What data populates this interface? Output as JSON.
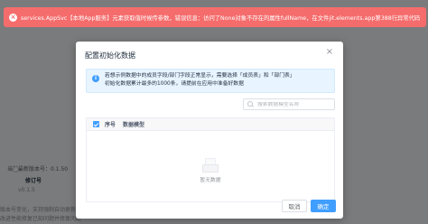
{
  "toast": {
    "type": "error",
    "message": "services.AppSvc【本地App服务】元素获取值时候传参数，错误信息：访问了None对象不存在的属性fullName，在文件jit.elements.app第388行异常代码"
  },
  "background": {
    "version_label": "当前最新版本号：0.1.50",
    "revision_label": "修订号",
    "revision_value": "v0.1.5",
    "note_line_1": "版本号变化，支持强制自动更新，发",
    "note_line_2": "改进性能修复已知问题并修复问题"
  },
  "dialog": {
    "title": "配置初始化数据",
    "close_label": "×",
    "alert": {
      "line_1": "若想示例数据中的成员字段/部门字段正常显示，需要选择「成员表」和「部门表」",
      "line_2": "初始化数据累计最多的1000条，请提前在应用中准备好数据"
    },
    "search": {
      "placeholder": "搜索数据模型名称",
      "value": ""
    },
    "table": {
      "columns": [
        "序号",
        "数据模型"
      ],
      "rows": [],
      "empty_text": "暂无数据"
    },
    "buttons": {
      "cancel": "取消",
      "confirm": "确定"
    }
  },
  "colors": {
    "error": "#f56c6c",
    "primary": "#409eff",
    "info_bg": "#e8f4ff"
  }
}
